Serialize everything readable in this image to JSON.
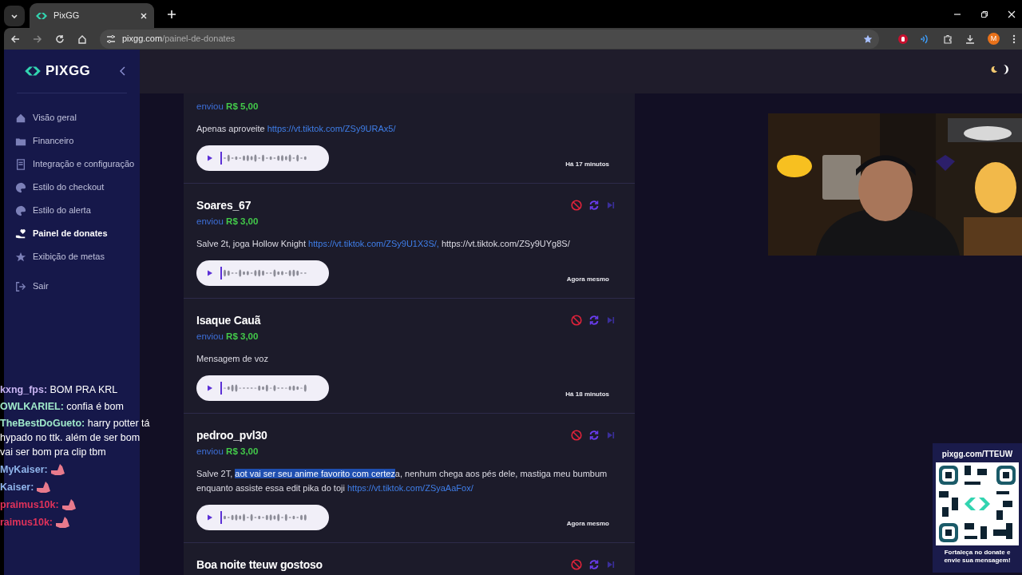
{
  "browser": {
    "tab_title": "PixGG",
    "url_host": "pixgg.com",
    "url_path": "/painel-de-donates",
    "profile_initial": "M"
  },
  "sidebar": {
    "logo": "PIXGG",
    "items": [
      {
        "label": "Visão geral",
        "selected": false
      },
      {
        "label": "Financeiro",
        "selected": false
      },
      {
        "label": "Integração e configuração",
        "selected": false
      },
      {
        "label": "Estilo do checkout",
        "selected": false
      },
      {
        "label": "Estilo do alerta",
        "selected": false
      },
      {
        "label": "Painel de donates",
        "selected": true
      },
      {
        "label": "Exibição de metas",
        "selected": false
      },
      {
        "label": "Sair",
        "selected": false
      }
    ]
  },
  "donations": [
    {
      "sent_label": "enviou",
      "amount": "R$ 5,00",
      "message": [
        {
          "kind": "text",
          "text": "Apenas aproveite "
        },
        {
          "kind": "link",
          "text": "https://vt.tiktok.com/ZSy9URAx5/"
        }
      ],
      "time": "Há 17 minutos"
    },
    {
      "name": "Soares_67",
      "sent_label": "enviou",
      "amount": "R$ 3,00",
      "message": [
        {
          "kind": "text",
          "text": "Salve 2t, joga Hollow Knight "
        },
        {
          "kind": "link",
          "text": "https://vt.tiktok.com/ZSy9U1X3S/,"
        },
        {
          "kind": "text",
          "text": " https://vt.tiktok.com/ZSy9UYg8S/"
        }
      ],
      "time": "Agora mesmo"
    },
    {
      "name": "Isaque Cauã",
      "sent_label": "enviou",
      "amount": "R$ 3,00",
      "message": [
        {
          "kind": "text",
          "text": "Mensagem de voz"
        }
      ],
      "time": "Há 18 minutos"
    },
    {
      "name": "pedroo_pvl30",
      "sent_label": "enviou",
      "amount": "R$ 3,00",
      "message": [
        {
          "kind": "text",
          "text": "Salve 2T, "
        },
        {
          "kind": "highlight",
          "text": "aot vai ser seu anime favorito com certez"
        },
        {
          "kind": "text",
          "text": "a, nenhum chega aos pés dele, mastiga meu bumbum enquanto assiste essa edit pika do toji "
        },
        {
          "kind": "link",
          "text": "https://vt.tiktok.com/ZSyaAaFox/"
        }
      ],
      "time": "Agora mesmo"
    },
    {
      "name": "Boa noite tteuw gostoso"
    }
  ],
  "chat": [
    {
      "kind": "text",
      "user": "kxng_fps:",
      "text": "BOM PRA KRL",
      "color": "#c7b3f0"
    },
    {
      "kind": "text",
      "user": "OWLKARIEL:",
      "text": "confia é bom",
      "color": "#9fe8c9"
    },
    {
      "kind": "text",
      "user": "TheBestDoGueto:",
      "text": "harry potter tá hypado no ttk. além de ser bom vai ser bom pra clip tbm",
      "color": "#9fe8c9"
    },
    {
      "kind": "emote",
      "user": "MyKaiser:",
      "color": "#8fb4ea"
    },
    {
      "kind": "emote",
      "user": "Kaiser:",
      "color": "#8fb4ea"
    },
    {
      "kind": "emote",
      "user": "praimus10k:",
      "color": "#e0325a"
    },
    {
      "kind": "emote",
      "user": "raimus10k:",
      "color": "#e0325a"
    }
  ],
  "donate_panel": {
    "url": "pixgg.com/TTEUW",
    "caption": "Fortaleça no donate e envie sua mensagem!"
  }
}
